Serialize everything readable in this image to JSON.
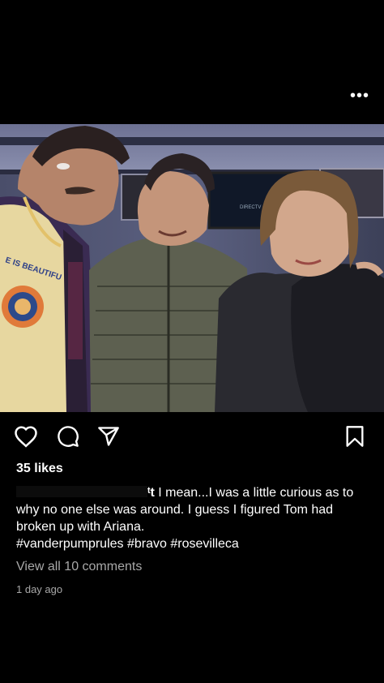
{
  "header": {
    "more_icon": "more-horizontal-icon",
    "more_label": "•••"
  },
  "post": {
    "photo_alt": "",
    "likes_text": "35 likes",
    "caption": {
      "username_fragment": "ᵗt",
      "text": " I mean...I was a little curious as to why no one else was around. I guess I figured Tom had broken up with Ariana.",
      "hashtags": "#vanderpumprules #bravo #rosevilleca"
    },
    "view_all_comments": "View all 10 comments",
    "timestamp": "1 day ago"
  },
  "actions": {
    "like_icon": "heart-icon",
    "comment_icon": "comment-icon",
    "share_icon": "share-icon",
    "save_icon": "bookmark-icon"
  },
  "photo_overlay": {
    "shirt_text": "E IS BEAUTIFU",
    "tv_text": "DIRECTV"
  }
}
